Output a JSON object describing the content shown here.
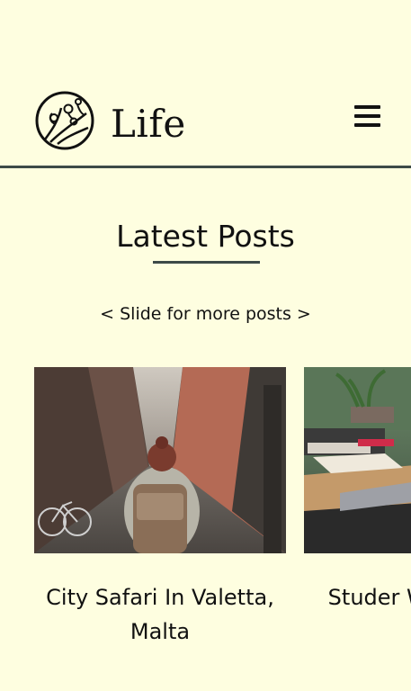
{
  "header": {
    "brand_name": "Life",
    "logo_icon": "tree-circle-icon",
    "menu_icon": "hamburger-menu-icon"
  },
  "main": {
    "section_title": "Latest Posts",
    "slide_hint": "< Slide for more posts >",
    "posts": [
      {
        "title": "City Safari In Valetta, Malta",
        "image": "woman-with-backpack-in-narrow-street-photo"
      },
      {
        "title": "Studer Wit",
        "image": "desk-with-books-and-plant-photo"
      }
    ]
  },
  "colors": {
    "background": "#fefee0",
    "divider": "#3d4a48",
    "text": "#111111"
  }
}
